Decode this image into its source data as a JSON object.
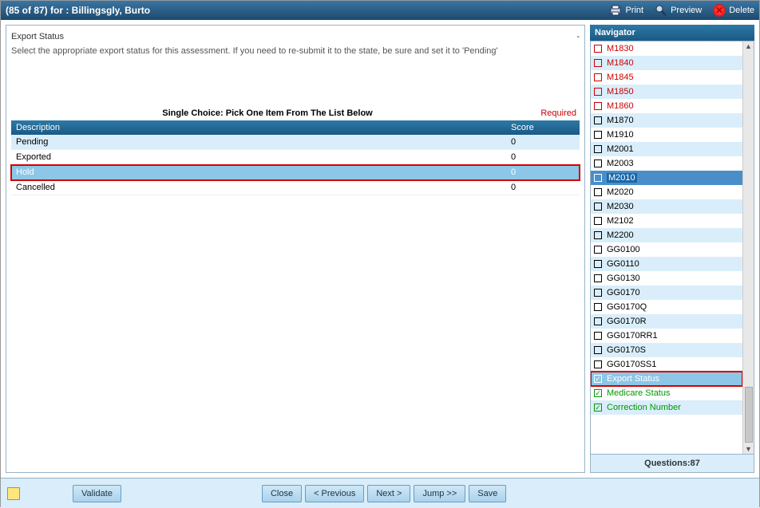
{
  "titlebar": {
    "title": "(85 of 87) for : Billingsgly, Burto",
    "print": "Print",
    "preview": "Preview",
    "delete": "Delete"
  },
  "section": {
    "title": "Export Status",
    "collapse": "-",
    "desc": "Select the appropriate export status for this assessment. If you need to re-submit it to the state, be sure and set it to 'Pending'",
    "single_choice": "Single Choice: Pick One Item From The List Below",
    "required": "Required"
  },
  "grid": {
    "col_desc": "Description",
    "col_score": "Score",
    "rows": [
      {
        "desc": "Pending",
        "score": "0"
      },
      {
        "desc": "Exported",
        "score": "0"
      },
      {
        "desc": "Hold",
        "score": "0"
      },
      {
        "desc": "Cancelled",
        "score": "0"
      }
    ]
  },
  "navigator": {
    "header": "Navigator",
    "footer": "Questions:87",
    "items": [
      {
        "label": "M1830",
        "state": "red"
      },
      {
        "label": "M1840",
        "state": "red"
      },
      {
        "label": "M1845",
        "state": "red"
      },
      {
        "label": "M1850",
        "state": "red"
      },
      {
        "label": "M1860",
        "state": "red"
      },
      {
        "label": "M1870",
        "state": "black"
      },
      {
        "label": "M1910",
        "state": "black"
      },
      {
        "label": "M2001",
        "state": "black"
      },
      {
        "label": "M2003",
        "state": "black"
      },
      {
        "label": "M2010",
        "state": "current"
      },
      {
        "label": "M2020",
        "state": "black"
      },
      {
        "label": "M2030",
        "state": "black"
      },
      {
        "label": "M2102",
        "state": "black"
      },
      {
        "label": "M2200",
        "state": "black"
      },
      {
        "label": "GG0100",
        "state": "black"
      },
      {
        "label": "GG0110",
        "state": "black"
      },
      {
        "label": "GG0130",
        "state": "black"
      },
      {
        "label": "GG0170",
        "state": "black"
      },
      {
        "label": "GG0170Q",
        "state": "black"
      },
      {
        "label": "GG0170R",
        "state": "black"
      },
      {
        "label": "GG0170RR1",
        "state": "black"
      },
      {
        "label": "GG0170S",
        "state": "black"
      },
      {
        "label": "GG0170SS1",
        "state": "black"
      },
      {
        "label": "Export Status",
        "state": "export"
      },
      {
        "label": "Medicare Status",
        "state": "green"
      },
      {
        "label": "Correction Number",
        "state": "green"
      }
    ]
  },
  "buttons": {
    "validate": "Validate",
    "close": "Close",
    "prev": "< Previous",
    "next": "Next >",
    "jump": "Jump >>",
    "save": "Save"
  }
}
